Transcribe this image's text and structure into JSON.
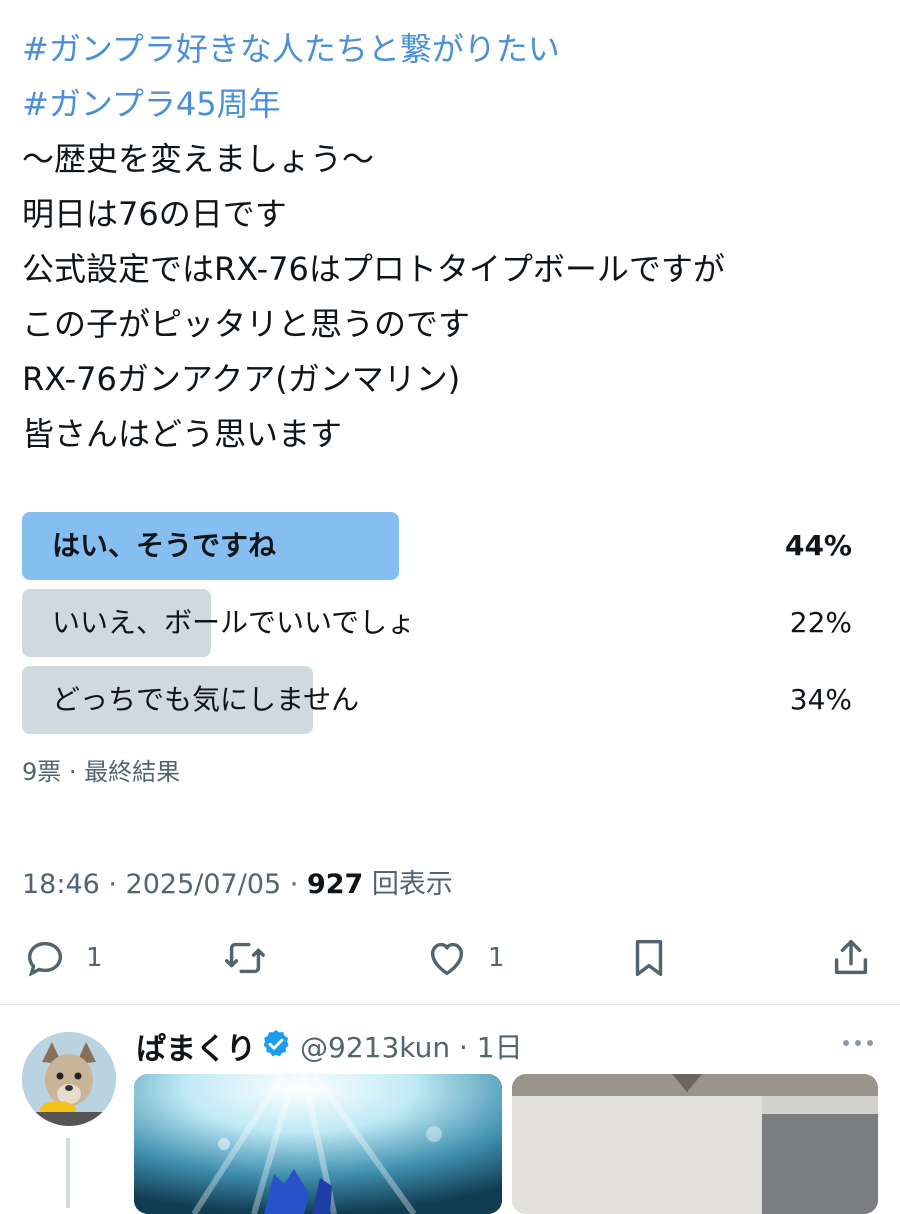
{
  "post": {
    "lines": [
      {
        "text": "#ガンプラ好きな人たちと繋がりたい",
        "hashtag": true
      },
      {
        "text": "#ガンプラ45周年",
        "hashtag": true
      },
      {
        "text": "〜歴史を変えましょう〜",
        "hashtag": false
      },
      {
        "text": "明日は76の日です",
        "hashtag": false
      },
      {
        "text": "公式設定ではRX-76はプロトタイプボールですが",
        "hashtag": false
      },
      {
        "text": "この子がピッタリと思うのです",
        "hashtag": false
      },
      {
        "text": "RX-76ガンアクア(ガンマリン)",
        "hashtag": false
      },
      {
        "text": "皆さんはどう思います",
        "hashtag": false
      }
    ]
  },
  "poll": {
    "options": [
      {
        "label": "はい、そうですね",
        "percent_text": "44%",
        "share": 0.44,
        "winner": true
      },
      {
        "label": "いいえ、ボールでいいでしょ",
        "percent_text": "22%",
        "share": 0.22,
        "winner": false
      },
      {
        "label": "どっちでも気にしません",
        "percent_text": "34%",
        "share": 0.34,
        "winner": false
      }
    ],
    "meta": "9票 · 最終結果"
  },
  "timestamp": {
    "time_date": "18:46 · 2025/07/05 · ",
    "views_count": "927",
    "views_label": " 回表示"
  },
  "actions": {
    "reply_count": "1",
    "like_count": "1"
  },
  "reply": {
    "display_name": "ぱまくり",
    "handle_line": "@9213kun · 1日"
  },
  "colors": {
    "hashtag": "#4a90d9",
    "poll_winner": "#85bff2",
    "poll_other": "#cfd9de",
    "muted": "#536471",
    "verified": "#1d9bf0"
  }
}
